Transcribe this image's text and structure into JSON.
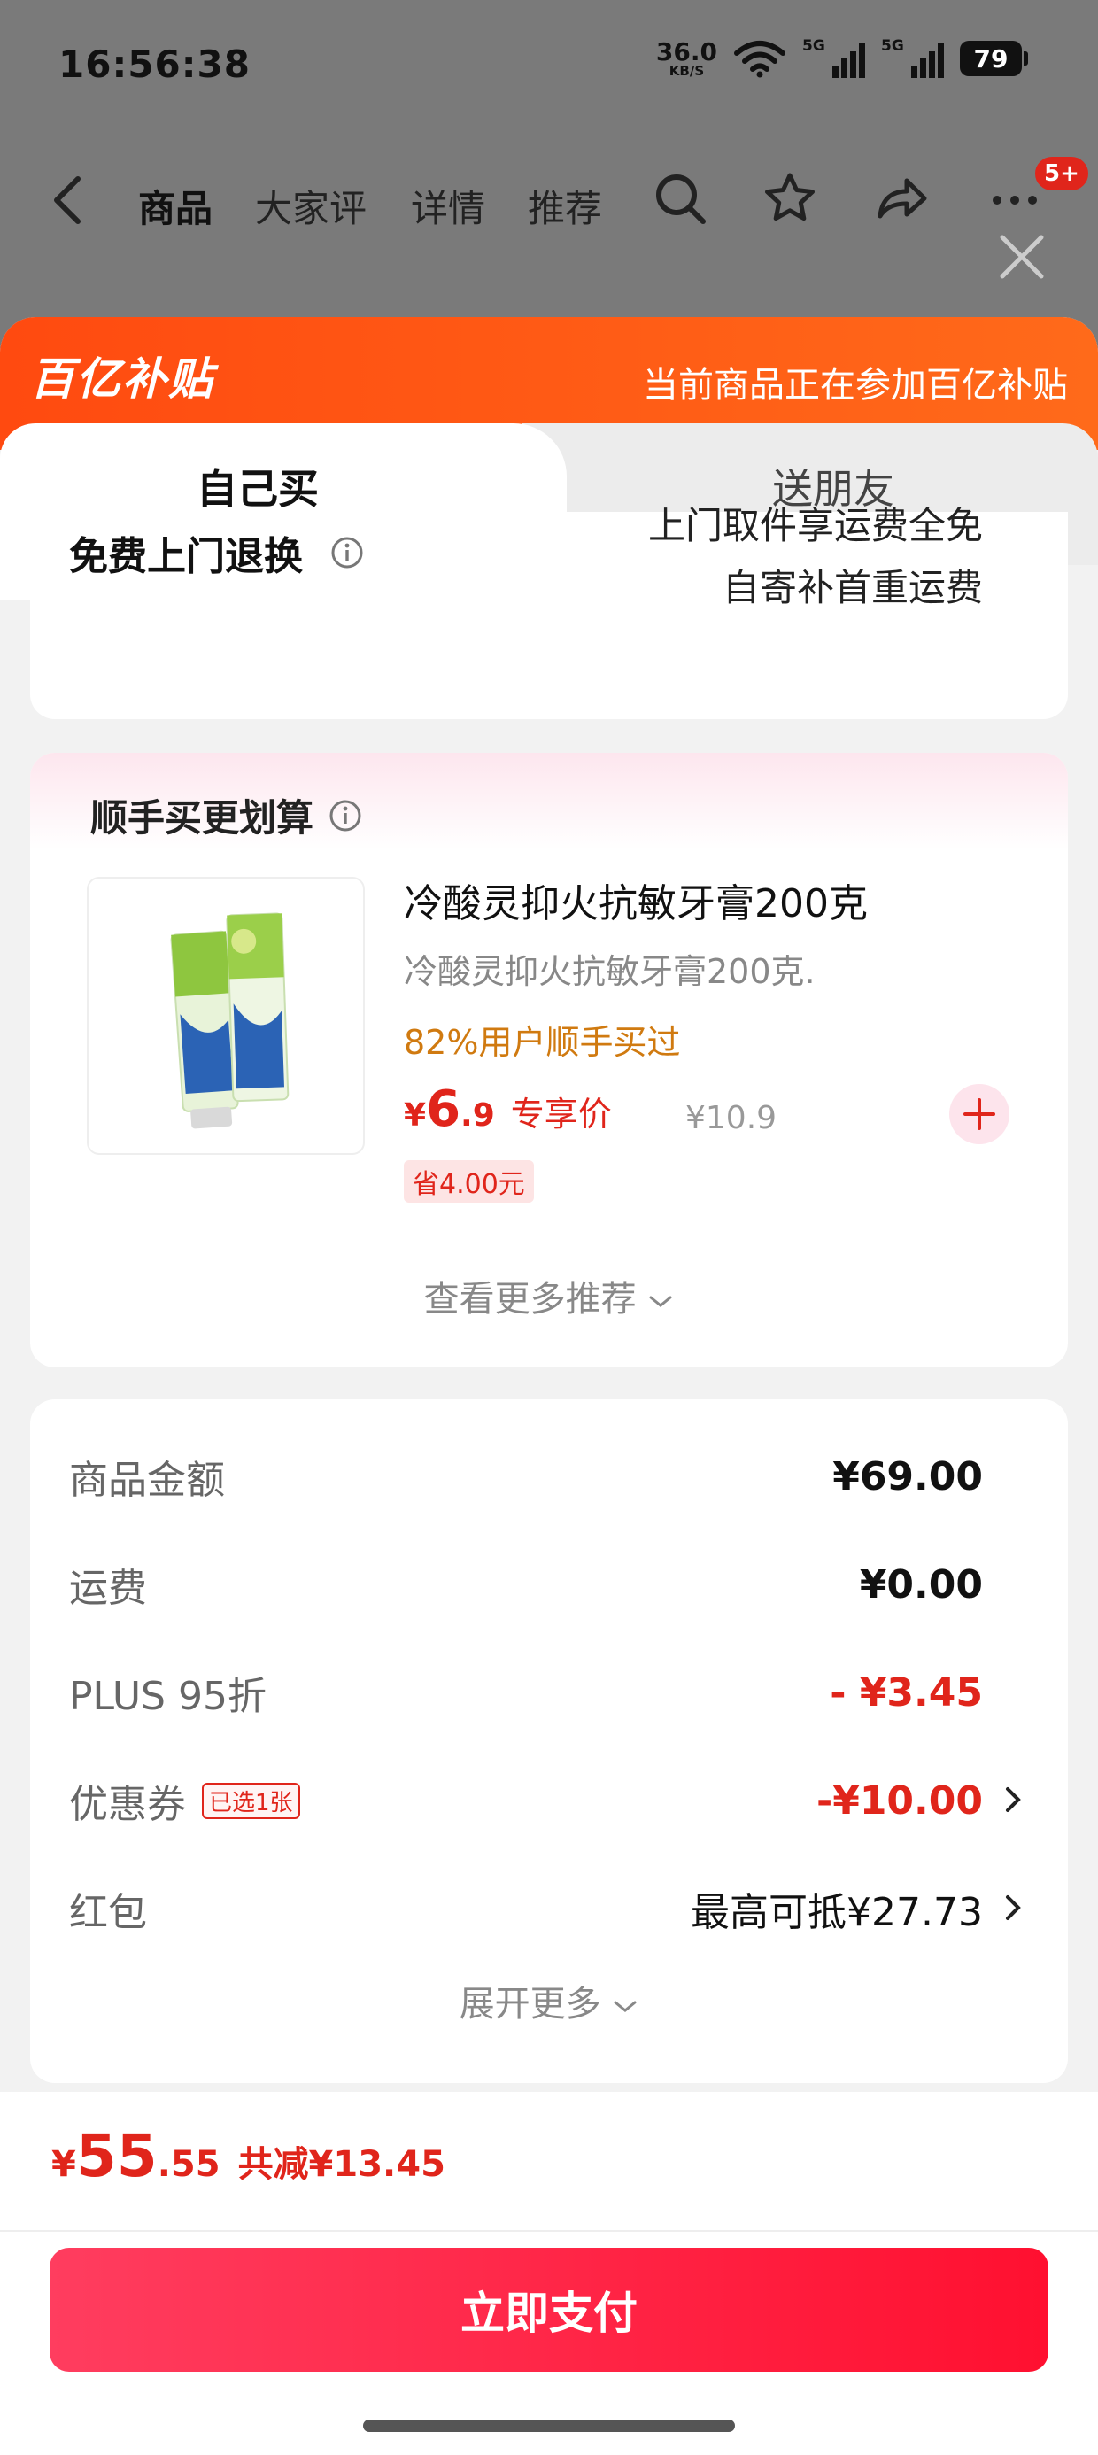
{
  "status": {
    "time": "16:56:38",
    "speed_value": "36.0",
    "speed_unit": "KB/S",
    "net1": "5G",
    "net2": "5G",
    "battery": "79"
  },
  "nav": {
    "tabs": [
      "商品",
      "大家评",
      "详情",
      "推荐"
    ],
    "active_tab": "商品",
    "badge": "5+"
  },
  "sheet": {
    "subsidy_logo": "百亿补贴",
    "subsidy_notice": "当前商品正在参加百亿补贴",
    "tab_self": "自己买",
    "tab_friend": "送朋友",
    "return_title": "免费上门退换",
    "return_line1": "上门取件享运费全免",
    "return_line2": "自寄补首重运费"
  },
  "recommend": {
    "title": "顺手买更划算",
    "product_name": "冷酸灵抑火抗敏牙膏200克",
    "product_sub": "冷酸灵抑火抗敏牙膏200克.",
    "buyers": "82%用户顺手买过",
    "price_currency": "¥",
    "price_int": "6",
    "price_dec": ".9",
    "price_label": "专享价",
    "orig_price": "¥10.9",
    "save": "省4.00元",
    "more": "查看更多推荐"
  },
  "summary": {
    "rows": [
      {
        "label": "商品金额",
        "value": "¥69.00"
      },
      {
        "label": "运费",
        "value": "¥0.00"
      },
      {
        "label": "PLUS 95折",
        "value": "- ¥3.45"
      },
      {
        "label": "优惠券",
        "tag": "已选1张",
        "value": "-¥10.00"
      },
      {
        "label": "红包",
        "value": "最高可抵¥27.73"
      }
    ],
    "expand": "展开更多"
  },
  "bottom": {
    "currency": "¥",
    "total_int": "55",
    "total_dec": ".55",
    "saved": "共减¥13.45",
    "pay_label": "立即支付"
  },
  "colors": {
    "accent_red": "#e0251b",
    "subsidy_orange": "#ff4a10",
    "pay_button": "#ff1030"
  }
}
